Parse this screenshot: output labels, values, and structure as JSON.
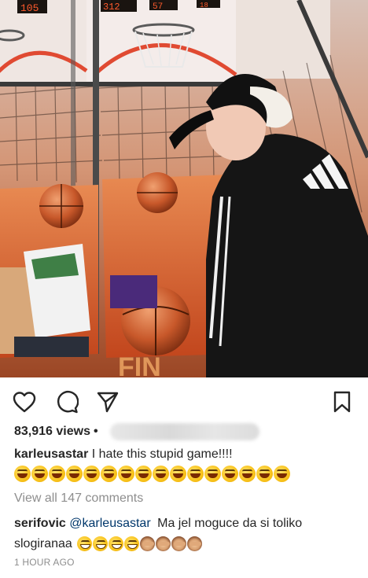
{
  "post": {
    "views_count": "83,916 views",
    "views_separator": "•",
    "caption": {
      "username": "karleusastar",
      "text": "I hate this stupid game!!!!",
      "emoji_name": "rolling-on-floor-laughing",
      "emoji_count": 16
    },
    "view_all_comments": "View all 147 comments",
    "comment": {
      "username": "serifovic",
      "mention": "@karleusastar",
      "text": "Ma jel moguce da si toliko",
      "text_line2": "slogiranaa",
      "emojis": [
        "grinning-squinting-face",
        "grinning-squinting-face",
        "grinning-squinting-face",
        "grinning-squinting-face",
        "see-no-evil-monkey",
        "see-no-evil-monkey",
        "see-no-evil-monkey",
        "see-no-evil-monkey"
      ]
    },
    "timestamp": "1 HOUR AGO"
  },
  "media": {
    "scoreboard_left": "105",
    "scoreboard_mid": "312",
    "scoreboard_mid2": "57",
    "scoreboard_right": "18",
    "game_label": "FIN"
  },
  "actions": {
    "like_icon": "heart-icon",
    "comment_icon": "comment-icon",
    "share_icon": "paper-plane-icon",
    "save_icon": "bookmark-icon"
  }
}
